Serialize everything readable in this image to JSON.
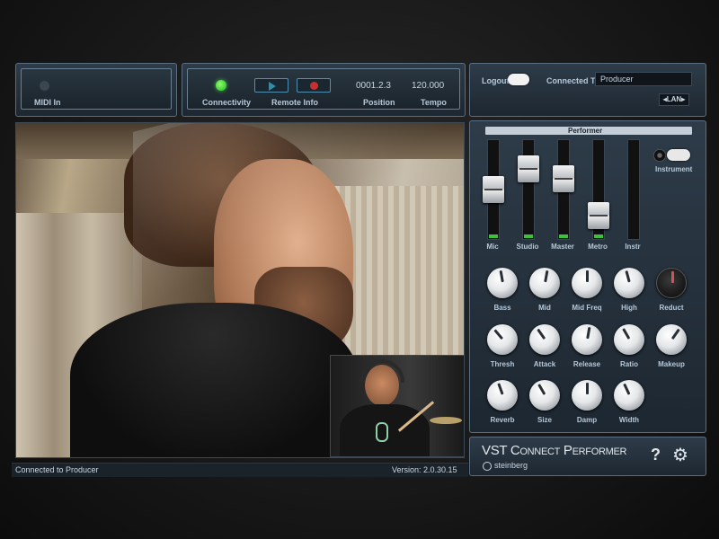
{
  "top_left": {
    "midi_label": "MIDI In"
  },
  "transport": {
    "connectivity": "Connectivity",
    "remote_info": "Remote Info",
    "position_label": "Position",
    "tempo_label": "Tempo",
    "position": "0001.2.3",
    "tempo": "120.000"
  },
  "connection": {
    "logout": "Logout",
    "connected_to_label": "Connected To",
    "connected_to_value": "Producer",
    "lan": "LAN"
  },
  "performer": {
    "title": "Performer",
    "faders": [
      {
        "label": "Mic",
        "level": 0.5
      },
      {
        "label": "Studio",
        "level": 0.78
      },
      {
        "label": "Master",
        "level": 0.65
      },
      {
        "label": "Metro",
        "level": 0.15
      },
      {
        "label": "Instr",
        "level": 0
      }
    ],
    "instrument": "Instrument"
  },
  "knobs": {
    "row1": [
      "Bass",
      "Mid",
      "Mid Freq",
      "High",
      "Reduct"
    ],
    "row2": [
      "Thresh",
      "Attack",
      "Release",
      "Ratio",
      "Makeup"
    ],
    "row3": [
      "Reverb",
      "Size",
      "Damp",
      "Width"
    ]
  },
  "brand": {
    "product": "VST Connect Performer",
    "company": "steinberg"
  },
  "status": {
    "left": "Connected to Producer",
    "version": "Version: 2.0.30.15"
  },
  "colors": {
    "accent": "#3cc13c",
    "record": "#d03030"
  }
}
